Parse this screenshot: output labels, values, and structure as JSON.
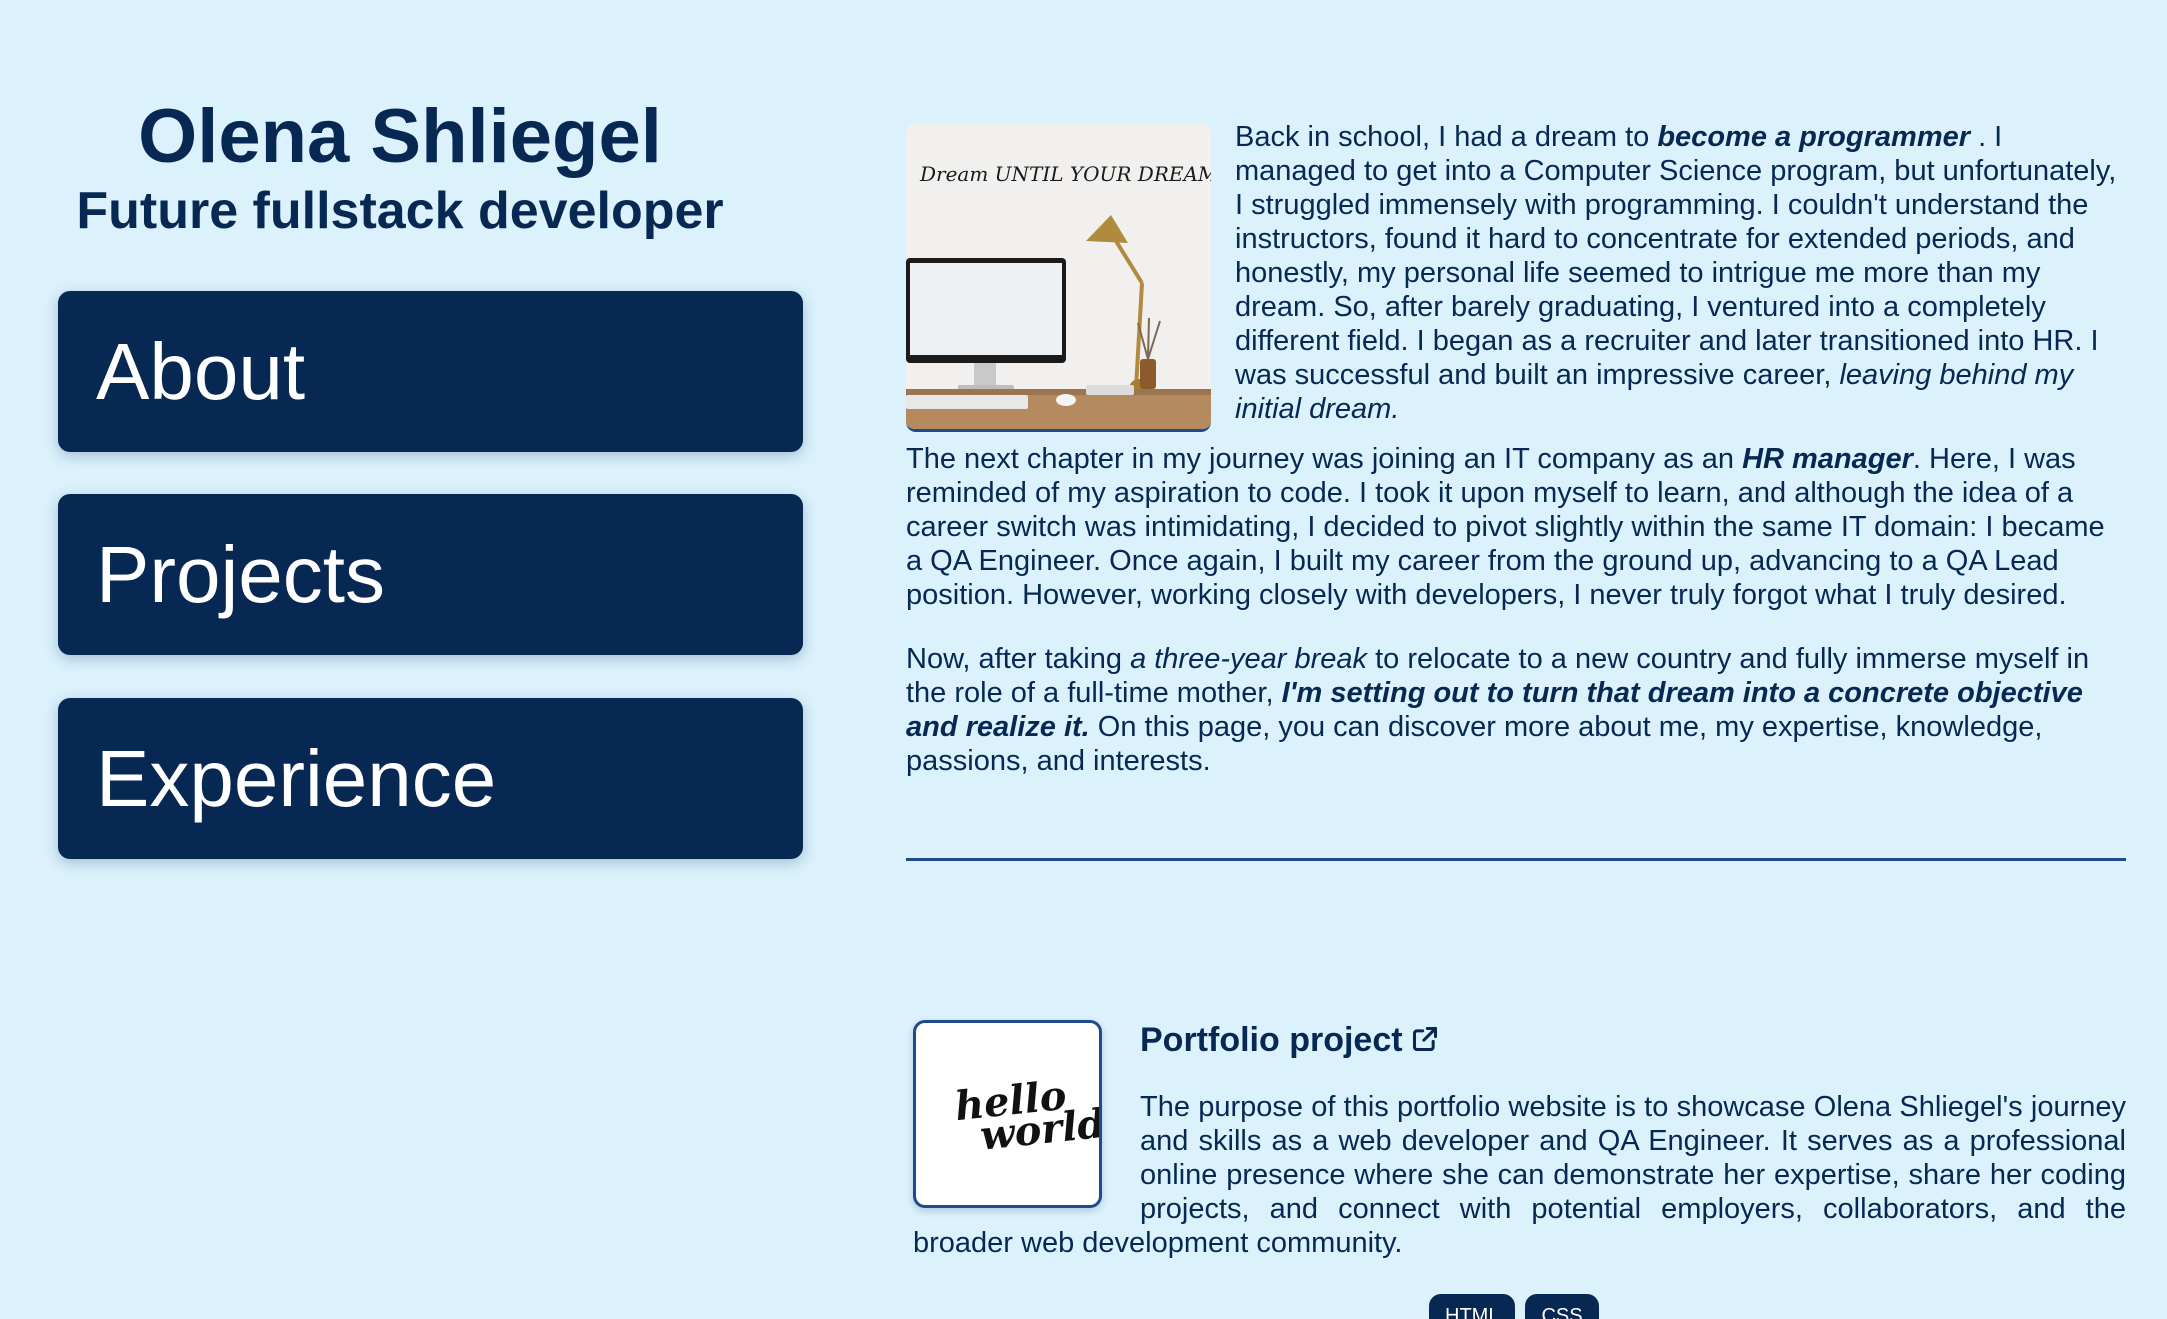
{
  "header": {
    "name": "Olena Shliegel",
    "subtitle": "Future fullstack developer"
  },
  "nav": {
    "items": [
      {
        "label": "About"
      },
      {
        "label": "Projects"
      },
      {
        "label": "Experience"
      }
    ]
  },
  "about": {
    "image_caption": "Dream UNTIL YOUR DREAMS come true.",
    "p1": {
      "t1": "Back in school, I had a dream to ",
      "em1": "become a programmer",
      "t2": " . I managed to get into a Computer Science program, but unfortunately, I struggled immensely with programming. I couldn't understand the instructors, found it hard to concentrate for extended periods, and honestly, my personal life seemed to intrigue me more than my dream. So, after barely graduating, I ventured into a completely different field. I began as a recruiter and later transitioned into HR. I was successful and built an impressive career, ",
      "it1": "leaving behind my initial dream."
    },
    "p2": {
      "t1": "The next chapter in my journey was joining an IT company as an ",
      "em1": "HR manager",
      "t2": ". Here, I was reminded of my aspiration to code. I took it upon myself to learn, and although the idea of a career switch was intimidating, I decided to pivot slightly within the same IT domain: I became a QA Engineer. Once again, I built my career from the ground up, advancing to a QA Lead position. However, working closely with developers, I never truly forgot what I truly desired."
    },
    "p3": {
      "t1": "Now, after taking ",
      "it1": "a three-year break",
      "t2": " to relocate to a new country and fully immerse myself in the role of a full-time mother, ",
      "em1": "I'm setting out to turn that dream into a concrete objective and realize it.",
      "t3": " On this page, you can discover more about me, my expertise, knowledge, passions, and interests."
    }
  },
  "project": {
    "thumb_text_1": "hello",
    "thumb_text_2": "world",
    "title": "Portfolio project",
    "description": "The purpose of this portfolio website is to showcase Olena Shliegel's journey and skills as a web developer and QA Engineer. It serves as a professional online presence where she can demonstrate her expertise, share her coding projects, and connect with potential employers, collaborators, and the broader web development community.",
    "tags": [
      "HTML",
      "CSS"
    ]
  },
  "colors": {
    "background": "#dbf2fd",
    "primary": "#062852",
    "accent_line": "#1f4a8c"
  }
}
